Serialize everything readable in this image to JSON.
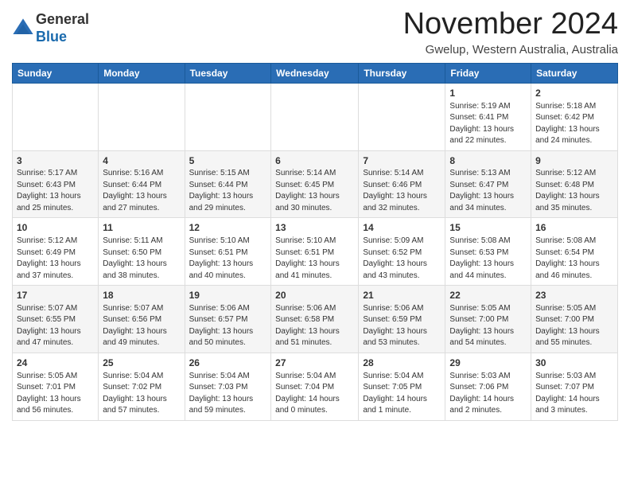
{
  "header": {
    "logo_line1": "General",
    "logo_line2": "Blue",
    "month_title": "November 2024",
    "location": "Gwelup, Western Australia, Australia"
  },
  "weekdays": [
    "Sunday",
    "Monday",
    "Tuesday",
    "Wednesday",
    "Thursday",
    "Friday",
    "Saturday"
  ],
  "weeks": [
    [
      {
        "day": "",
        "info": ""
      },
      {
        "day": "",
        "info": ""
      },
      {
        "day": "",
        "info": ""
      },
      {
        "day": "",
        "info": ""
      },
      {
        "day": "",
        "info": ""
      },
      {
        "day": "1",
        "info": "Sunrise: 5:19 AM\nSunset: 6:41 PM\nDaylight: 13 hours\nand 22 minutes."
      },
      {
        "day": "2",
        "info": "Sunrise: 5:18 AM\nSunset: 6:42 PM\nDaylight: 13 hours\nand 24 minutes."
      }
    ],
    [
      {
        "day": "3",
        "info": "Sunrise: 5:17 AM\nSunset: 6:43 PM\nDaylight: 13 hours\nand 25 minutes."
      },
      {
        "day": "4",
        "info": "Sunrise: 5:16 AM\nSunset: 6:44 PM\nDaylight: 13 hours\nand 27 minutes."
      },
      {
        "day": "5",
        "info": "Sunrise: 5:15 AM\nSunset: 6:44 PM\nDaylight: 13 hours\nand 29 minutes."
      },
      {
        "day": "6",
        "info": "Sunrise: 5:14 AM\nSunset: 6:45 PM\nDaylight: 13 hours\nand 30 minutes."
      },
      {
        "day": "7",
        "info": "Sunrise: 5:14 AM\nSunset: 6:46 PM\nDaylight: 13 hours\nand 32 minutes."
      },
      {
        "day": "8",
        "info": "Sunrise: 5:13 AM\nSunset: 6:47 PM\nDaylight: 13 hours\nand 34 minutes."
      },
      {
        "day": "9",
        "info": "Sunrise: 5:12 AM\nSunset: 6:48 PM\nDaylight: 13 hours\nand 35 minutes."
      }
    ],
    [
      {
        "day": "10",
        "info": "Sunrise: 5:12 AM\nSunset: 6:49 PM\nDaylight: 13 hours\nand 37 minutes."
      },
      {
        "day": "11",
        "info": "Sunrise: 5:11 AM\nSunset: 6:50 PM\nDaylight: 13 hours\nand 38 minutes."
      },
      {
        "day": "12",
        "info": "Sunrise: 5:10 AM\nSunset: 6:51 PM\nDaylight: 13 hours\nand 40 minutes."
      },
      {
        "day": "13",
        "info": "Sunrise: 5:10 AM\nSunset: 6:51 PM\nDaylight: 13 hours\nand 41 minutes."
      },
      {
        "day": "14",
        "info": "Sunrise: 5:09 AM\nSunset: 6:52 PM\nDaylight: 13 hours\nand 43 minutes."
      },
      {
        "day": "15",
        "info": "Sunrise: 5:08 AM\nSunset: 6:53 PM\nDaylight: 13 hours\nand 44 minutes."
      },
      {
        "day": "16",
        "info": "Sunrise: 5:08 AM\nSunset: 6:54 PM\nDaylight: 13 hours\nand 46 minutes."
      }
    ],
    [
      {
        "day": "17",
        "info": "Sunrise: 5:07 AM\nSunset: 6:55 PM\nDaylight: 13 hours\nand 47 minutes."
      },
      {
        "day": "18",
        "info": "Sunrise: 5:07 AM\nSunset: 6:56 PM\nDaylight: 13 hours\nand 49 minutes."
      },
      {
        "day": "19",
        "info": "Sunrise: 5:06 AM\nSunset: 6:57 PM\nDaylight: 13 hours\nand 50 minutes."
      },
      {
        "day": "20",
        "info": "Sunrise: 5:06 AM\nSunset: 6:58 PM\nDaylight: 13 hours\nand 51 minutes."
      },
      {
        "day": "21",
        "info": "Sunrise: 5:06 AM\nSunset: 6:59 PM\nDaylight: 13 hours\nand 53 minutes."
      },
      {
        "day": "22",
        "info": "Sunrise: 5:05 AM\nSunset: 7:00 PM\nDaylight: 13 hours\nand 54 minutes."
      },
      {
        "day": "23",
        "info": "Sunrise: 5:05 AM\nSunset: 7:00 PM\nDaylight: 13 hours\nand 55 minutes."
      }
    ],
    [
      {
        "day": "24",
        "info": "Sunrise: 5:05 AM\nSunset: 7:01 PM\nDaylight: 13 hours\nand 56 minutes."
      },
      {
        "day": "25",
        "info": "Sunrise: 5:04 AM\nSunset: 7:02 PM\nDaylight: 13 hours\nand 57 minutes."
      },
      {
        "day": "26",
        "info": "Sunrise: 5:04 AM\nSunset: 7:03 PM\nDaylight: 13 hours\nand 59 minutes."
      },
      {
        "day": "27",
        "info": "Sunrise: 5:04 AM\nSunset: 7:04 PM\nDaylight: 14 hours\nand 0 minutes."
      },
      {
        "day": "28",
        "info": "Sunrise: 5:04 AM\nSunset: 7:05 PM\nDaylight: 14 hours\nand 1 minute."
      },
      {
        "day": "29",
        "info": "Sunrise: 5:03 AM\nSunset: 7:06 PM\nDaylight: 14 hours\nand 2 minutes."
      },
      {
        "day": "30",
        "info": "Sunrise: 5:03 AM\nSunset: 7:07 PM\nDaylight: 14 hours\nand 3 minutes."
      }
    ]
  ]
}
